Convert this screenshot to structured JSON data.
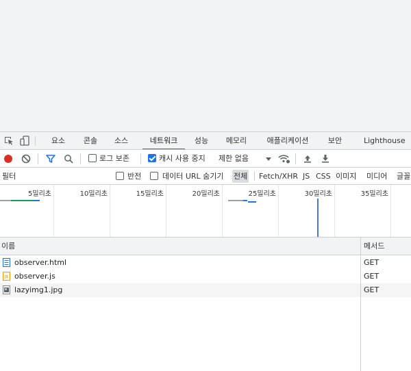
{
  "devtools": {
    "tabs": [
      {
        "label": "요소"
      },
      {
        "label": "콘솔"
      },
      {
        "label": "소스"
      },
      {
        "label": "네트워크"
      },
      {
        "label": "성능"
      },
      {
        "label": "메모리"
      },
      {
        "label": "애플리케이션"
      },
      {
        "label": "보안"
      },
      {
        "label": "Lighthouse"
      }
    ],
    "active_tab": "네트워크",
    "toolbar": {
      "preserve_log_label": "로그 보존",
      "preserve_log_checked": false,
      "disable_cache_label": "캐시 사용 중지",
      "disable_cache_checked": true,
      "throttling_value": "제한 없음"
    },
    "filter": {
      "placeholder": "필터",
      "invert_label": "반전",
      "hide_data_urls_label": "데이터 URL 숨기기",
      "types": [
        "전체",
        "Fetch/XHR",
        "JS",
        "CSS",
        "이미지",
        "미디어",
        "글꼴"
      ],
      "active_type": "전체"
    },
    "overview": {
      "ticks": [
        "5밀리초",
        "10밀리초",
        "15밀리초",
        "20밀리초",
        "25밀리초",
        "30밀리초",
        "35밀리초"
      ]
    },
    "table": {
      "columns": [
        "이름",
        "메서드"
      ],
      "rows": [
        {
          "name": "observer.html",
          "method": "GET",
          "type": "document"
        },
        {
          "name": "observer.js",
          "method": "GET",
          "type": "script"
        },
        {
          "name": "lazyimg1.jpg",
          "method": "GET",
          "type": "image"
        }
      ]
    },
    "colors": {
      "accent": "#1a73e8",
      "record": "#d93025",
      "waiting_bar": "#9aa0a6",
      "receiving_bar": "#1a73e8",
      "load_marker": "#4a74d9"
    }
  }
}
